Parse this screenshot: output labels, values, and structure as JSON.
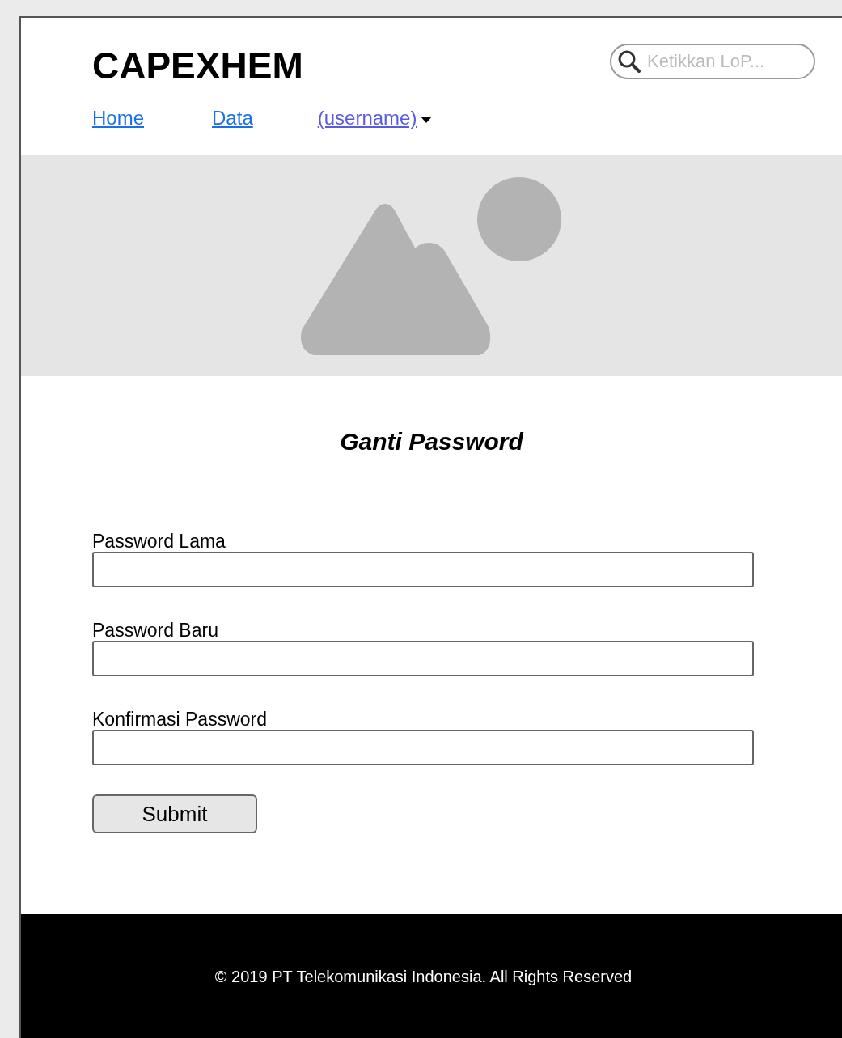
{
  "header": {
    "logo": "CAPEXHEM",
    "search": {
      "placeholder": "Ketikkan LoP..."
    },
    "nav": [
      {
        "label": "Home",
        "kind": "link"
      },
      {
        "label": "Data",
        "kind": "link"
      },
      {
        "label": "(username)",
        "kind": "dropdown"
      }
    ]
  },
  "hero": {
    "kind": "image-placeholder"
  },
  "form": {
    "title": "Ganti Password",
    "fields": [
      {
        "label": "Password Lama"
      },
      {
        "label": "Password Baru"
      },
      {
        "label": "Konfirmasi Password"
      }
    ],
    "submit": "Submit"
  },
  "footer": {
    "text": "© 2019 PT Telekomunikasi Indonesia. All Rights Reserved"
  }
}
